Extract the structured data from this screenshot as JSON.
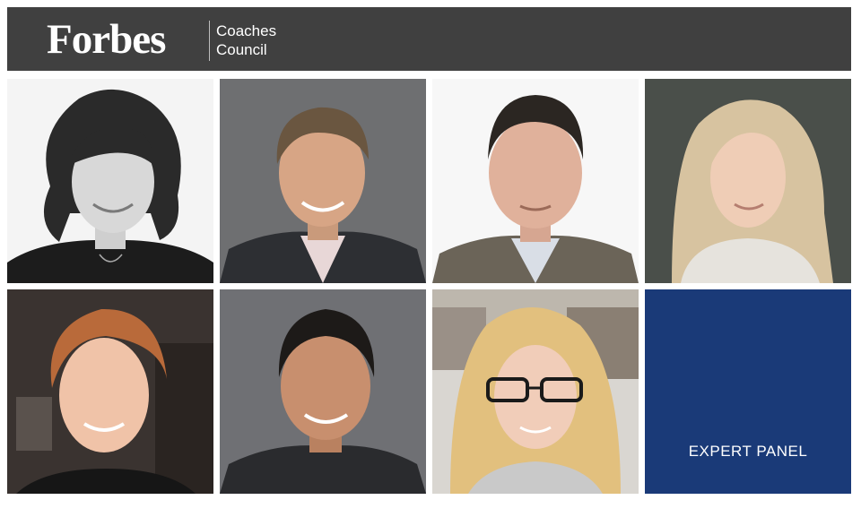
{
  "header": {
    "logo_text": "Forbes",
    "council_line1": "Coaches",
    "council_line2": "Council"
  },
  "panel": {
    "label": "EXPERT PANEL"
  },
  "colors": {
    "header_bg": "#404040",
    "panel_bg": "#1a3a78",
    "page_bg": "#ffffff"
  }
}
